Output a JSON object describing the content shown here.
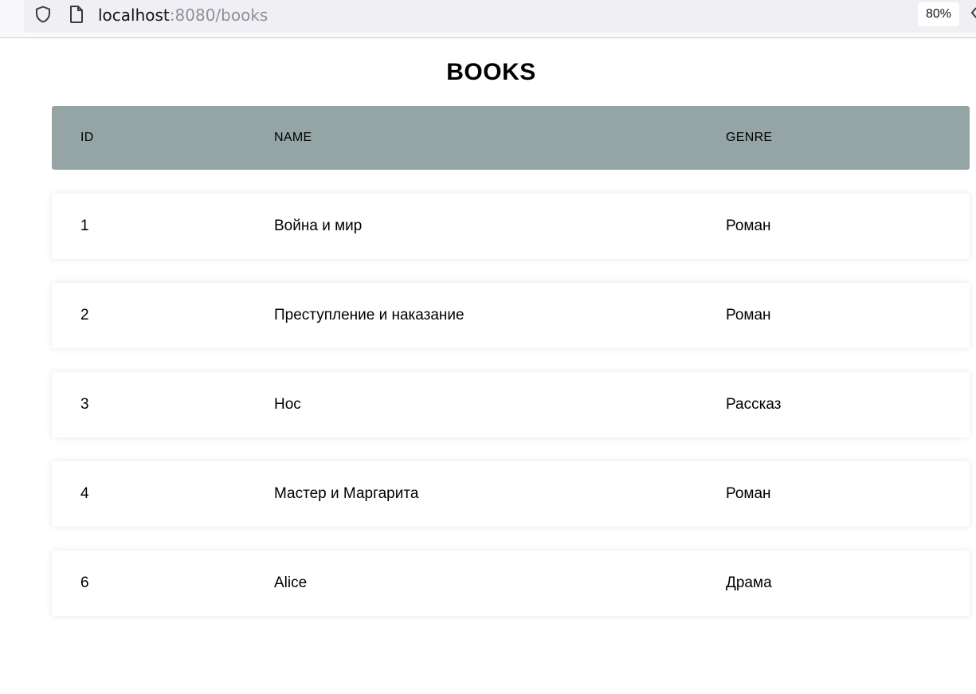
{
  "browser": {
    "url_host": "localhost",
    "url_rest": ":8080/books",
    "zoom": "80%",
    "icons": [
      "shield-icon",
      "page-icon",
      "overflow-icon"
    ]
  },
  "page": {
    "title": "BOOKS"
  },
  "table": {
    "columns": [
      "ID",
      "NAME",
      "GENRE"
    ],
    "rows": [
      {
        "id": "1",
        "name": "Война и мир",
        "genre": "Роман"
      },
      {
        "id": "2",
        "name": "Преступление и наказание",
        "genre": "Роман"
      },
      {
        "id": "3",
        "name": "Нос",
        "genre": "Рассказ"
      },
      {
        "id": "4",
        "name": "Мастер и Маргарита",
        "genre": "Роман"
      },
      {
        "id": "6",
        "name": "Alice",
        "genre": "Драма"
      }
    ]
  },
  "colors": {
    "header_bg": "#95a5a6",
    "row_bg": "#ffffff",
    "toolbar_bg": "#f9f9fb",
    "urlbar_bg": "#f0f0f4"
  }
}
